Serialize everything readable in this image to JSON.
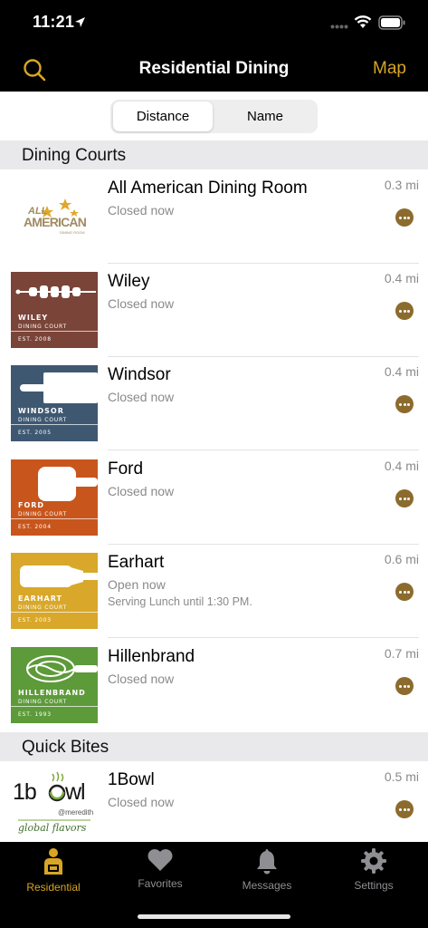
{
  "status_bar": {
    "time": "11:21"
  },
  "nav": {
    "title": "Residential Dining",
    "map_label": "Map",
    "search_icon": "search-icon"
  },
  "sort": {
    "options": [
      "Distance",
      "Name"
    ],
    "selected": "Distance"
  },
  "sections": {
    "dining_courts": {
      "title": "Dining Courts",
      "items": [
        {
          "name": "All American Dining Room",
          "status": "Closed now",
          "distance": "0.3 mi",
          "logo_text": [
            "ALL",
            "AMERICAN",
            "DINING ROOM"
          ]
        },
        {
          "name": "Wiley",
          "status": "Closed now",
          "distance": "0.4 mi",
          "tile": {
            "name": "WILEY",
            "court": "DINING COURT",
            "est": "EST. 2008",
            "color": "#7a4438"
          }
        },
        {
          "name": "Windsor",
          "status": "Closed now",
          "distance": "0.4 mi",
          "tile": {
            "name": "WINDSOR",
            "court": "DINING COURT",
            "est": "EST. 2005",
            "color": "#3f5872"
          }
        },
        {
          "name": "Ford",
          "status": "Closed now",
          "distance": "0.4 mi",
          "tile": {
            "name": "FORD",
            "court": "DINING COURT",
            "est": "EST. 2004",
            "color": "#c8561c"
          }
        },
        {
          "name": "Earhart",
          "status": "Open now",
          "detail": "Serving Lunch until 1:30 PM.",
          "distance": "0.6 mi",
          "tile": {
            "name": "EARHART",
            "court": "DINING COURT",
            "est": "EST. 2003",
            "color": "#d9a82a"
          }
        },
        {
          "name": "Hillenbrand",
          "status": "Closed now",
          "distance": "0.7 mi",
          "tile": {
            "name": "HILLENBRAND",
            "court": "DINING COURT",
            "est": "EST. 1993",
            "color": "#5d9a3a"
          }
        }
      ]
    },
    "quick_bites": {
      "title": "Quick Bites",
      "items": [
        {
          "name": "1Bowl",
          "status": "Closed now",
          "distance": "0.5 mi",
          "logo_text": [
            "1b",
            "wl",
            "@meredith",
            "global flavors"
          ]
        }
      ]
    }
  },
  "tabs": [
    {
      "label": "Residential",
      "icon": "residential-icon",
      "active": true
    },
    {
      "label": "Favorites",
      "icon": "heart-icon",
      "active": false
    },
    {
      "label": "Messages",
      "icon": "bell-icon",
      "active": false
    },
    {
      "label": "Settings",
      "icon": "gear-icon",
      "active": false
    }
  ],
  "colors": {
    "accent": "#d8a524",
    "more_button": "#8c6b2e",
    "bar": "#000000"
  }
}
